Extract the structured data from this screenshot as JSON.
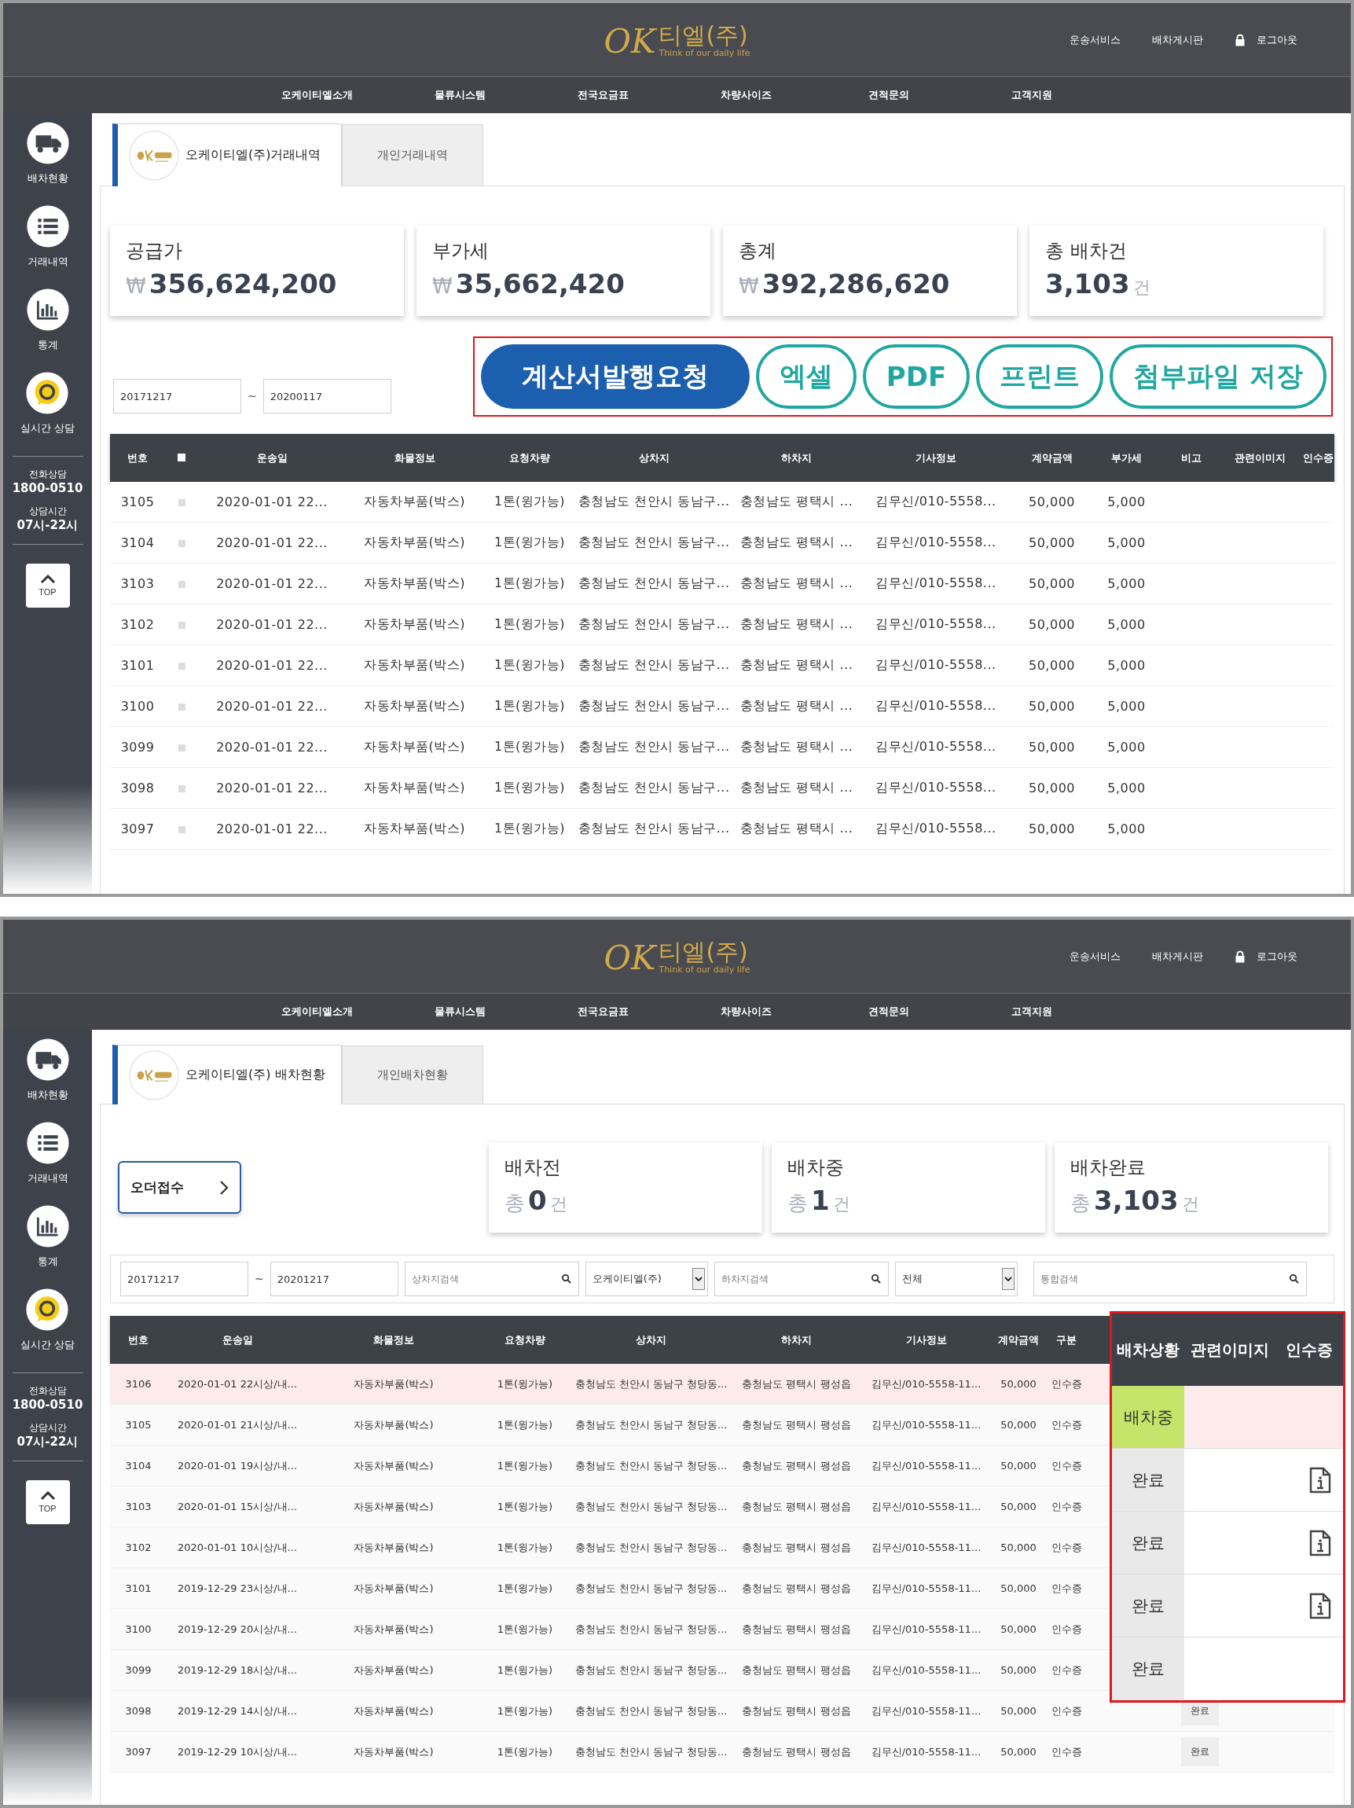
{
  "screens": [
    {
      "kind": "transactions",
      "header": {
        "logo_mark": "OK",
        "logo_name": "티엘(주)",
        "logo_slogan": "Think of our daily life",
        "links": [
          {
            "label": "운송서비스",
            "kind": "plain"
          },
          {
            "label": "배차게시판",
            "kind": "plain"
          },
          {
            "label": "로그아웃",
            "kind": "lock"
          }
        ]
      },
      "nav": [
        "오케이티엘소개",
        "물류시스템",
        "전국요금표",
        "차량사이즈",
        "견적문의",
        "고객지원"
      ],
      "sidebar": {
        "items": [
          {
            "label": "배차현황",
            "kind": "truck"
          },
          {
            "label": "거래내역",
            "kind": "list"
          },
          {
            "label": "통계",
            "kind": "chart"
          },
          {
            "label": "실시간 상담",
            "kind": "chat"
          }
        ],
        "phone_label": "전화상담",
        "phone": "1800-0510",
        "hours_label": "상담시간",
        "hours": "07시-22시",
        "top_button": "TOP"
      },
      "tabs": [
        {
          "label": "오케이티엘(주)거래내역",
          "selected": true,
          "kind": "logo"
        },
        {
          "label": "개인거래내역",
          "selected": false,
          "kind": "plain"
        }
      ],
      "cards": [
        {
          "label": "공급가",
          "prefix": "₩",
          "value": "356,624,200"
        },
        {
          "label": "부가세",
          "prefix": "₩",
          "value": "35,662,420"
        },
        {
          "label": "총계",
          "prefix": "₩",
          "value": "392,286,620"
        },
        {
          "label": "총 배차건",
          "value": "3,103",
          "unit": "건"
        }
      ],
      "filters": [
        {
          "kind": "date",
          "value": "20171217"
        },
        {
          "kind": "tilde",
          "text": "~"
        },
        {
          "kind": "date",
          "value": "20200117"
        }
      ],
      "actions": [
        {
          "label": "계산서발행요청",
          "kind": "primary"
        },
        {
          "label": "엑셀",
          "kind": "outline"
        },
        {
          "label": "PDF",
          "kind": "outline"
        },
        {
          "label": "프린트",
          "kind": "outline"
        },
        {
          "label": "첨부파일 저장",
          "kind": "outline"
        }
      ],
      "table": {
        "columns": [
          {
            "label": "번호"
          },
          {
            "kind": "checkbox",
            "checked": false
          },
          {
            "label": "운송일"
          },
          {
            "label": "화물정보"
          },
          {
            "label": "요청차량"
          },
          {
            "label": "상차지"
          },
          {
            "label": "하차지"
          },
          {
            "label": "기사정보"
          },
          {
            "label": "계약금액"
          },
          {
            "label": "부가세"
          },
          {
            "label": "비고"
          },
          {
            "label": "관련이미지"
          },
          {
            "label": "인수증"
          }
        ],
        "rows": [
          {
            "checked": false,
            "cells": [
              "3105",
              "",
              "2020-01-01 22...",
              "자동차부품(박스)",
              "1톤(윙가능)",
              "충청남도 천안시 동남구...",
              "충청남도 평택시 ...",
              "김무신/010-5558...",
              "50,000",
              "5,000"
            ]
          },
          {
            "checked": false,
            "cells": [
              "3104",
              "",
              "2020-01-01 22...",
              "자동차부품(박스)",
              "1톤(윙가능)",
              "충청남도 천안시 동남구...",
              "충청남도 평택시 ...",
              "김무신/010-5558...",
              "50,000",
              "5,000"
            ]
          },
          {
            "checked": false,
            "cells": [
              "3103",
              "",
              "2020-01-01 22...",
              "자동차부품(박스)",
              "1톤(윙가능)",
              "충청남도 천안시 동남구...",
              "충청남도 평택시 ...",
              "김무신/010-5558...",
              "50,000",
              "5,000"
            ]
          },
          {
            "checked": false,
            "cells": [
              "3102",
              "",
              "2020-01-01 22...",
              "자동차부품(박스)",
              "1톤(윙가능)",
              "충청남도 천안시 동남구...",
              "충청남도 평택시 ...",
              "김무신/010-5558...",
              "50,000",
              "5,000"
            ]
          },
          {
            "checked": false,
            "cells": [
              "3101",
              "",
              "2020-01-01 22...",
              "자동차부품(박스)",
              "1톤(윙가능)",
              "충청남도 천안시 동남구...",
              "충청남도 평택시 ...",
              "김무신/010-5558...",
              "50,000",
              "5,000"
            ]
          },
          {
            "checked": false,
            "cells": [
              "3100",
              "",
              "2020-01-01 22...",
              "자동차부품(박스)",
              "1톤(윙가능)",
              "충청남도 천안시 동남구...",
              "충청남도 평택시 ...",
              "김무신/010-5558...",
              "50,000",
              "5,000"
            ]
          },
          {
            "checked": false,
            "cells": [
              "3099",
              "",
              "2020-01-01 22...",
              "자동차부품(박스)",
              "1톤(윙가능)",
              "충청남도 천안시 동남구...",
              "충청남도 평택시 ...",
              "김무신/010-5558...",
              "50,000",
              "5,000"
            ]
          },
          {
            "checked": false,
            "cells": [
              "3098",
              "",
              "2020-01-01 22...",
              "자동차부품(박스)",
              "1톤(윙가능)",
              "충청남도 천안시 동남구...",
              "충청남도 평택시 ...",
              "김무신/010-5558...",
              "50,000",
              "5,000"
            ]
          },
          {
            "checked": false,
            "cells": [
              "3097",
              "",
              "2020-01-01 22...",
              "자동차부품(박스)",
              "1톤(윙가능)",
              "충청남도 천안시 동남구...",
              "충청남도 평택시 ...",
              "김무신/010-5558...",
              "50,000",
              "5,000"
            ]
          }
        ]
      }
    },
    {
      "kind": "dispatch",
      "header": {
        "logo_mark": "OK",
        "logo_name": "티엘(주)",
        "logo_slogan": "Think of our daily life",
        "links": [
          {
            "label": "운송서비스",
            "kind": "plain"
          },
          {
            "label": "배차게시판",
            "kind": "plain"
          },
          {
            "label": "로그아웃",
            "kind": "lock"
          }
        ]
      },
      "nav": [
        "오케이티엘소개",
        "물류시스템",
        "전국요금표",
        "차량사이즈",
        "견적문의",
        "고객지원"
      ],
      "sidebar": {
        "items": [
          {
            "label": "배차현황",
            "kind": "truck"
          },
          {
            "label": "거래내역",
            "kind": "list"
          },
          {
            "label": "통계",
            "kind": "chart"
          },
          {
            "label": "실시간 상담",
            "kind": "chat"
          }
        ],
        "phone_label": "전화상담",
        "phone": "1800-0510",
        "hours_label": "상담시간",
        "hours": "07시-22시",
        "top_button": "TOP"
      },
      "tabs": [
        {
          "label": "오케이티엘(주) 배차현황",
          "selected": true,
          "kind": "logo"
        },
        {
          "label": "개인배차현황",
          "selected": false,
          "kind": "plain"
        }
      ],
      "order_button": "오더접수",
      "cards": [
        {
          "label": "배차전",
          "prefix": "총",
          "value": "0",
          "unit": "건"
        },
        {
          "label": "배차중",
          "prefix": "총",
          "value": "1",
          "unit": "건"
        },
        {
          "label": "배차완료",
          "prefix": "총",
          "value": "3,103",
          "unit": "건"
        }
      ],
      "filters": [
        {
          "kind": "date",
          "value": "20171217"
        },
        {
          "kind": "tilde",
          "text": "~"
        },
        {
          "kind": "date",
          "value": "20201217"
        },
        {
          "kind": "search",
          "placeholder": "상차지검색"
        },
        {
          "kind": "select",
          "value": "오케이티엘(주)"
        },
        {
          "kind": "search",
          "placeholder": "하차지검색"
        },
        {
          "kind": "select",
          "value": "전체"
        },
        {
          "kind": "wide_search",
          "placeholder": "통합검색"
        }
      ],
      "table": {
        "columns": [
          {
            "label": "번호"
          },
          {
            "label": "운송일"
          },
          {
            "label": "화물정보"
          },
          {
            "label": "요청차량"
          },
          {
            "label": "상차지"
          },
          {
            "label": "하차지"
          },
          {
            "label": "기사정보"
          },
          {
            "label": "계약금액"
          },
          {
            "label": "구분"
          }
        ],
        "rows": [
          {
            "highlighted": true,
            "cells": [
              "3106",
              "2020-01-01 22시상/내...",
              "자동차부품(박스)",
              "1톤(윙가능)",
              "충청남도 천안시 동남구 청당동...",
              "충청남도 평택시 팽성읍",
              "김무신/010-5558-11...",
              "50,000",
              "인수증"
            ]
          },
          {
            "highlighted": false,
            "cells": [
              "3105",
              "2020-01-01 21시상/내...",
              "자동차부품(박스)",
              "1톤(윙가능)",
              "충청남도 천안시 동남구 청당동...",
              "충청남도 평택시 팽성읍",
              "김무신/010-5558-11...",
              "50,000",
              "인수증"
            ]
          },
          {
            "highlighted": false,
            "cells": [
              "3104",
              "2020-01-01 19시상/내...",
              "자동차부품(박스)",
              "1톤(윙가능)",
              "충청남도 천안시 동남구 청당동...",
              "충청남도 평택시 팽성읍",
              "김무신/010-5558-11...",
              "50,000",
              "인수증"
            ]
          },
          {
            "highlighted": false,
            "cells": [
              "3103",
              "2020-01-01 15시상/내...",
              "자동차부품(박스)",
              "1톤(윙가능)",
              "충청남도 천안시 동남구 청당동...",
              "충청남도 평택시 팽성읍",
              "김무신/010-5558-11...",
              "50,000",
              "인수증"
            ]
          },
          {
            "highlighted": false,
            "cells": [
              "3102",
              "2020-01-01 10시상/내...",
              "자동차부품(박스)",
              "1톤(윙가능)",
              "충청남도 천안시 동남구 청당동...",
              "충청남도 평택시 팽성읍",
              "김무신/010-5558-11...",
              "50,000",
              "인수증"
            ]
          },
          {
            "highlighted": false,
            "cells": [
              "3101",
              "2019-12-29 23시상/내...",
              "자동차부품(박스)",
              "1톤(윙가능)",
              "충청남도 천안시 동남구 청당동...",
              "충청남도 평택시 팽성읍",
              "김무신/010-5558-11...",
              "50,000",
              "인수증"
            ]
          },
          {
            "highlighted": false,
            "cells": [
              "3100",
              "2019-12-29 20시상/내...",
              "자동차부품(박스)",
              "1톤(윙가능)",
              "충청남도 천안시 동남구 청당동...",
              "충청남도 평택시 팽성읍",
              "김무신/010-5558-11...",
              "50,000",
              "인수증"
            ]
          },
          {
            "highlighted": false,
            "cells": [
              "3099",
              "2019-12-29 18시상/내...",
              "자동차부품(박스)",
              "1톤(윙가능)",
              "충청남도 천안시 동남구 청당동...",
              "충청남도 평택시 팽성읍",
              "김무신/010-5558-11...",
              "50,000",
              "인수증"
            ]
          },
          {
            "highlighted": false,
            "cells": [
              "3098",
              "2019-12-29 14시상/내...",
              "자동차부품(박스)",
              "1톤(윙가능)",
              "충청남도 천안시 동남구 청당동...",
              "충청남도 평택시 팽성읍",
              "김무신/010-5558-11...",
              "50,000",
              "인수증"
            ],
            "status": "완료"
          },
          {
            "highlighted": false,
            "cells": [
              "3097",
              "2019-12-29 10시상/내...",
              "자동차부품(박스)",
              "1톤(윙가능)",
              "충청남도 천안시 동남구 청당동...",
              "충청남도 평택시 팽성읍",
              "김무신/010-5558-11...",
              "50,000",
              "인수증"
            ],
            "status": "완료"
          }
        ]
      },
      "callout": {
        "columns": [
          "배차상황",
          "관련이미지",
          "인수증"
        ],
        "rows": [
          {
            "status": "배차중",
            "highlighted": true,
            "receipt": false
          },
          {
            "status": "완료",
            "highlighted": false,
            "receipt": true
          },
          {
            "status": "완료",
            "highlighted": false,
            "receipt": true
          },
          {
            "status": "완료",
            "highlighted": false,
            "receipt": true
          },
          {
            "status": "완료",
            "highlighted": false,
            "receipt": false
          }
        ]
      }
    }
  ]
}
